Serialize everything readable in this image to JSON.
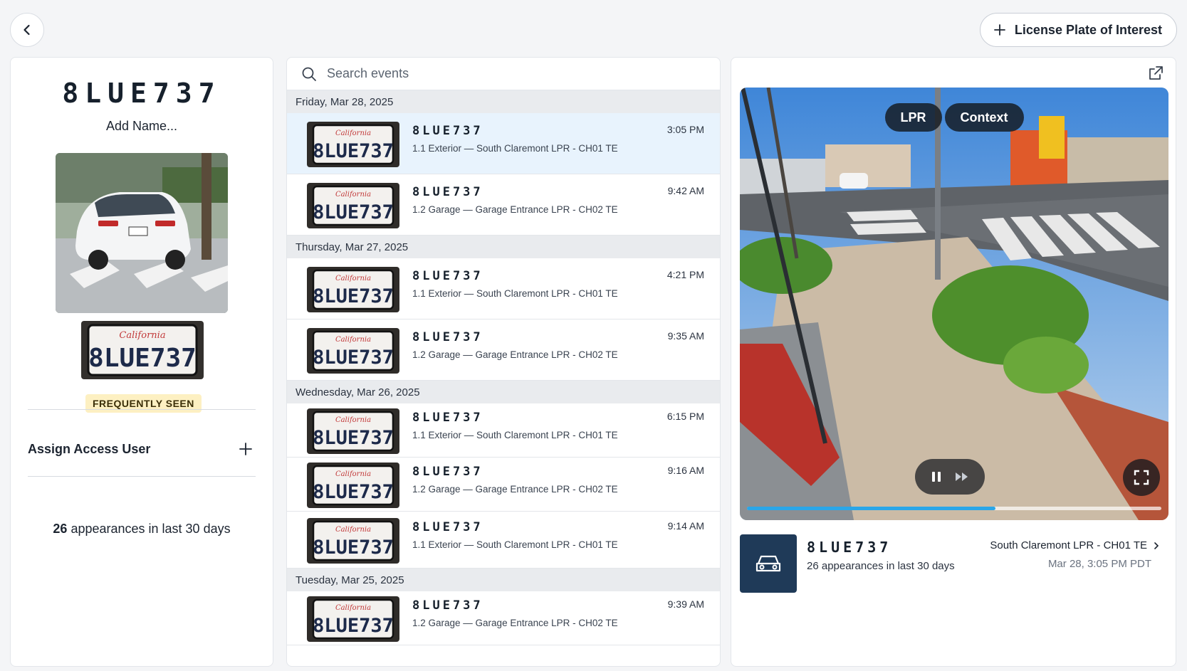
{
  "toolbar": {
    "lpi_label": "License Plate of Interest"
  },
  "plate": {
    "number": "8LUE737",
    "name_placeholder": "Add Name...",
    "status": "FREQUENTLY SEEN",
    "plate_state": "California",
    "assign_label": "Assign Access User",
    "appearances_count": "26",
    "appearances_text": " appearances in last 30 days"
  },
  "search": {
    "placeholder": "Search events"
  },
  "event_groups": [
    {
      "date": "Friday, Mar 28, 2025",
      "events": [
        {
          "plate": "8LUE737",
          "location": "1.1 Exterior — South Claremont LPR - CH01 TE",
          "time": "3:05 PM"
        },
        {
          "plate": "8LUE737",
          "location": "1.2 Garage — Garage Entrance LPR - CH02 TE",
          "time": "9:42 AM"
        }
      ]
    },
    {
      "date": "Thursday, Mar 27, 2025",
      "events": [
        {
          "plate": "8LUE737",
          "location": "1.1 Exterior — South Claremont LPR - CH01 TE",
          "time": "4:21 PM"
        },
        {
          "plate": "8LUE737",
          "location": "1.2 Garage — Garage Entrance LPR - CH02 TE",
          "time": "9:35 AM"
        }
      ]
    },
    {
      "date": "Wednesday, Mar 26, 2025",
      "events": [
        {
          "plate": "8LUE737",
          "location": "1.1 Exterior — South Claremont LPR - CH01 TE",
          "time": "6:15 PM"
        },
        {
          "plate": "8LUE737",
          "location": "1.2 Garage — Garage Entrance LPR - CH02 TE",
          "time": "9:16 AM"
        },
        {
          "plate": "8LUE737",
          "location": "1.1 Exterior — South Claremont LPR - CH01 TE",
          "time": "9:14 AM"
        }
      ]
    },
    {
      "date": "Tuesday, Mar 25, 2025",
      "events": [
        {
          "plate": "8LUE737",
          "location": "1.2 Garage — Garage Entrance LPR - CH02 TE",
          "time": "9:39 AM"
        }
      ]
    }
  ],
  "video": {
    "tab_lpr": "LPR",
    "tab_context": "Context",
    "progress_fraction": 0.6
  },
  "detail": {
    "plate": "8LUE737",
    "appearances": "26 appearances in last 30 days",
    "camera": "South Claremont LPR - CH01 TE",
    "timestamp": "Mar 28, 3:05 PM PDT"
  },
  "colors": {
    "accent": "#2aa6e8",
    "selected_row": "#e8f3fd",
    "badge_bg": "#fdf0c2",
    "detail_icon_bg": "#1f3a58"
  },
  "icons": [
    "chevron-left-icon",
    "plus-icon",
    "search-icon",
    "popout-icon",
    "pause-icon",
    "fast-forward-icon",
    "fullscreen-icon",
    "car-icon",
    "chevron-right-icon"
  ]
}
